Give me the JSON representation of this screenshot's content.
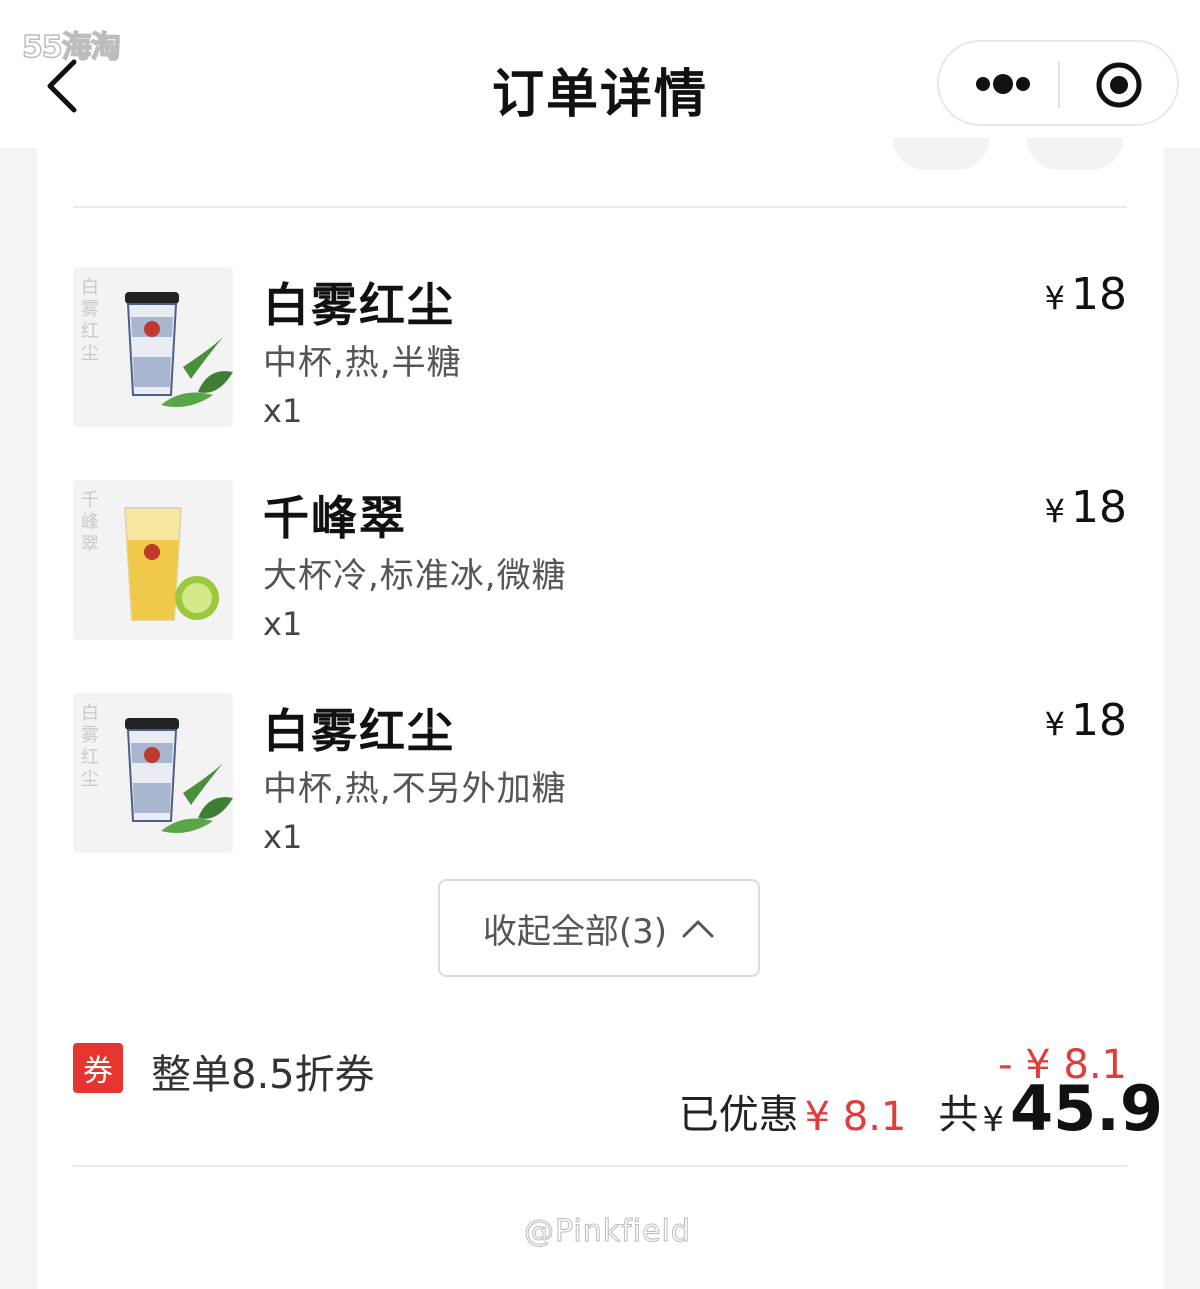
{
  "header": {
    "title": "订单详情",
    "watermark": "55海淘"
  },
  "items": [
    {
      "name": "白雾红尘",
      "spec": "中杯,热,半糖",
      "qty": "x1",
      "currency": "¥",
      "price": "18",
      "image": "milk-tea-cup-blue-pattern"
    },
    {
      "name": "千峰翠",
      "spec": "大杯冷,标准冰,微糖",
      "qty": "x1",
      "currency": "¥",
      "price": "18",
      "image": "iced-lemon-tea-cup"
    },
    {
      "name": "白雾红尘",
      "spec": "中杯,热,不另外加糖",
      "qty": "x1",
      "currency": "¥",
      "price": "18",
      "image": "milk-tea-cup-blue-pattern"
    }
  ],
  "collapse_button": {
    "label": "收起全部(3)"
  },
  "coupon": {
    "badge": "券",
    "label": "整单8.5折券",
    "amount": "- ¥ 8.1"
  },
  "summary": {
    "discount_label": "已优惠",
    "discount_amount": "¥ 8.1",
    "total_label": "共",
    "total_currency": "¥",
    "total": "45.9"
  },
  "watermark_bottom": "@Pinkfield",
  "colors": {
    "accent_red": "#e23b3b",
    "badge_red": "#e5352e"
  }
}
